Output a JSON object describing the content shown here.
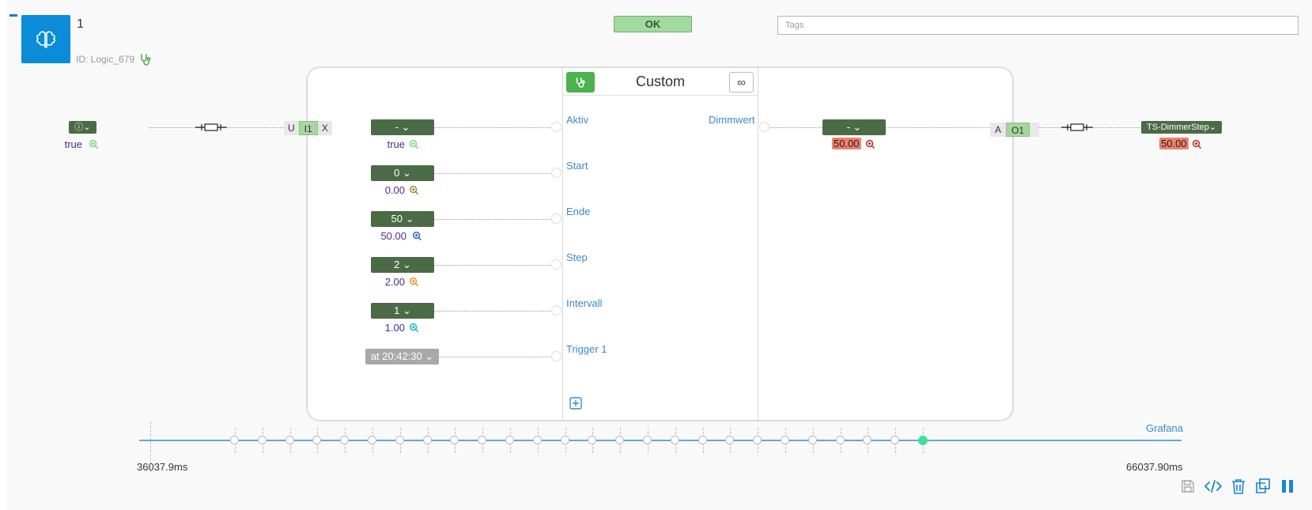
{
  "header": {
    "title": "1",
    "id_label": "ID: Logic_679",
    "ok_label": "OK",
    "tags_placeholder": "Tags"
  },
  "block": {
    "title": "Custom",
    "infinity_symbol": "∞",
    "inputs": [
      {
        "label": "Aktiv",
        "dropdown": "-",
        "value": "true"
      },
      {
        "label": "Start",
        "dropdown": "0",
        "value": "0.00"
      },
      {
        "label": "Ende",
        "dropdown": "50",
        "value": "50.00"
      },
      {
        "label": "Step",
        "dropdown": "2",
        "value": "2.00"
      },
      {
        "label": "Intervall",
        "dropdown": "1",
        "value": "1.00"
      },
      {
        "label": "Trigger 1",
        "dropdown": "at 20:42:30"
      }
    ],
    "outputs": [
      {
        "label": "Dimmwert",
        "dropdown": "-",
        "value": "50.00"
      }
    ]
  },
  "left_source": {
    "dropdown_icon": "question-icon",
    "value": "true",
    "u_label": "U",
    "i_label": "I1",
    "x_label": "X"
  },
  "right_target": {
    "a_label": "A",
    "o_label": "O1",
    "dropdown": "TS-DimmerStep",
    "value": "50.00"
  },
  "timeline": {
    "start_label": "36037.9ms",
    "end_label": "66037.90ms",
    "grafana_label": "Grafana",
    "tick_count": 26,
    "active_index": 25
  },
  "colors": {
    "accent_blue": "#0b8cd9",
    "dropdown_green": "#4b6b47",
    "ok_green": "#a3d9a0",
    "stethoscope_green": "#4db14d",
    "value_red": "#f08070",
    "timeline_active": "#3ee0a0"
  },
  "toolbar": {
    "icons": [
      "save-icon",
      "code-icon",
      "trash-icon",
      "copy-icon",
      "pause-icon"
    ]
  }
}
